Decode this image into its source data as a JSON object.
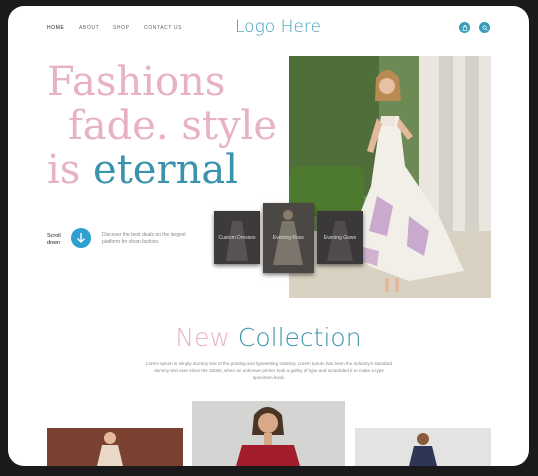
{
  "nav": {
    "links": [
      "HOME",
      "ABOUT",
      "SHOP",
      "CONTACT US"
    ],
    "logo": "Logo Here"
  },
  "hero": {
    "line1": "Fashions",
    "line2": "fade. style",
    "line3_prefix": "is",
    "line3_accent": "eternal",
    "scroll_label_1": "Scroll",
    "scroll_label_2": "down",
    "description": "Discover the best deals on the largest platform for clean fashion."
  },
  "thumbnails": [
    "Custom Dresses",
    "Evening Rose",
    "Evening Gown"
  ],
  "collection": {
    "title_pink": "New",
    "title_teal": "Collection",
    "description": "Lorem Ipsum is simply dummy text of the printing and typesetting industry. Lorem Ipsum has been the industry's standard dummy text ever since the 1500s, when an unknown printer took a galley of type and scrambled it to make a type specimen book."
  },
  "colors": {
    "pink": "#e7b1c6",
    "teal": "#3a93ad",
    "accent_blue": "#2d9fd0"
  }
}
